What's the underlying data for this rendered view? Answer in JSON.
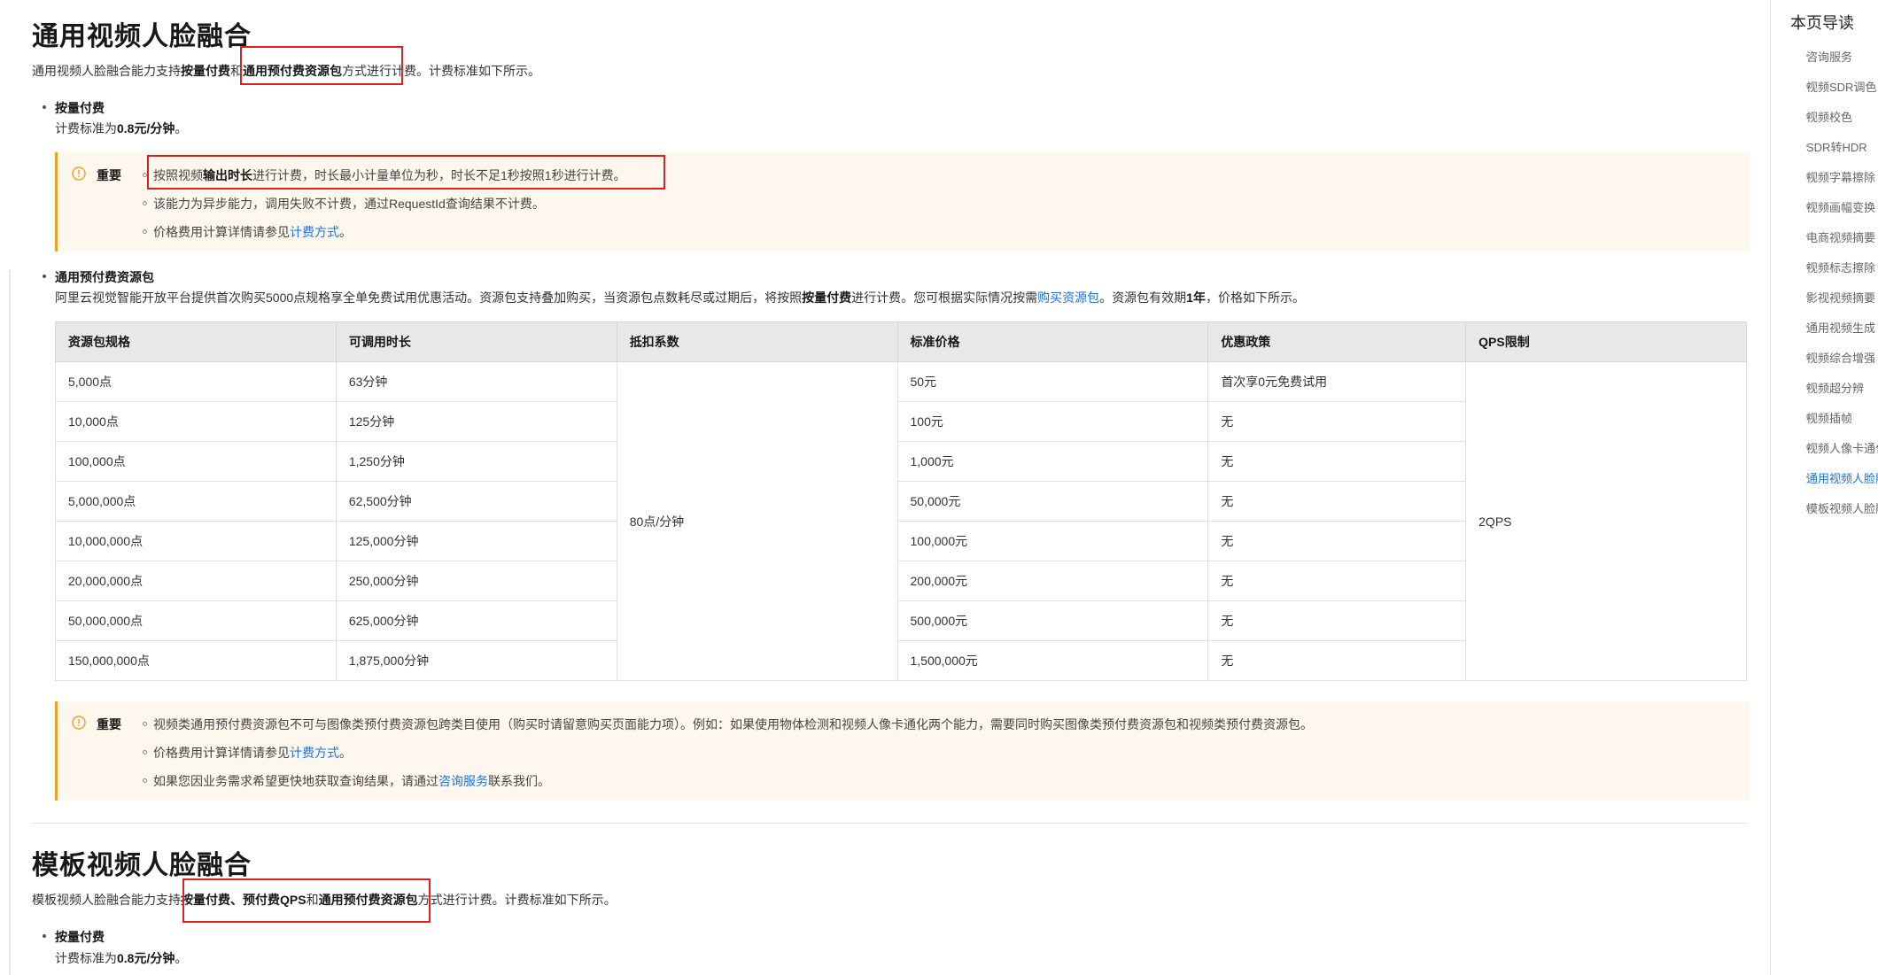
{
  "section1": {
    "title": "通用视频人脸融合",
    "intro_pre": "通用视频人脸融合能力支持",
    "intro_b1": "按量付费",
    "intro_mid": "和",
    "intro_b2": "通用预付费资源包",
    "intro_post": "方式进行计费。计费标准如下所示。",
    "payg_title": "按量付费",
    "payg_pre": "计费标准为",
    "payg_price": "0.8元/分钟",
    "payg_post": "。",
    "notice1": {
      "title": "重要",
      "item1_pre": "按照视频",
      "item1_b": "输出时长",
      "item1_post": "进行计费，时长最小计量单位为秒，时长不足1秒按照1秒进行计费。",
      "item2": "该能力为异步能力，调用失败不计费，通过RequestId查询结果不计费。",
      "item3_pre": "价格费用计算详情请参见",
      "item3_link": "计费方式",
      "item3_post": "。"
    },
    "prepaid_title": "通用预付费资源包",
    "prepaid_desc_pre": "阿里云视觉智能开放平台提供首次购买5000点规格享全单免费试用优惠活动。资源包支持叠加购买，当资源包点数耗尽或过期后，将按照",
    "prepaid_desc_b": "按量付费",
    "prepaid_desc_mid": "进行计费。您可根据实际情况按需",
    "prepaid_desc_link": "购买资源包",
    "prepaid_desc_mid2": "。资源包有效期",
    "prepaid_desc_b2": "1年",
    "prepaid_desc_post": "，价格如下所示。",
    "table": {
      "headers": [
        "资源包规格",
        "可调用时长",
        "抵扣系数",
        "标准价格",
        "优惠政策",
        "QPS限制"
      ],
      "deduction": "80点/分钟",
      "qps": "2QPS",
      "rows": [
        [
          "5,000点",
          "63分钟",
          "50元",
          "首次享0元免费试用"
        ],
        [
          "10,000点",
          "125分钟",
          "100元",
          "无"
        ],
        [
          "100,000点",
          "1,250分钟",
          "1,000元",
          "无"
        ],
        [
          "5,000,000点",
          "62,500分钟",
          "50,000元",
          "无"
        ],
        [
          "10,000,000点",
          "125,000分钟",
          "100,000元",
          "无"
        ],
        [
          "20,000,000点",
          "250,000分钟",
          "200,000元",
          "无"
        ],
        [
          "50,000,000点",
          "625,000分钟",
          "500,000元",
          "无"
        ],
        [
          "150,000,000点",
          "1,875,000分钟",
          "1,500,000元",
          "无"
        ]
      ]
    },
    "notice2": {
      "title": "重要",
      "item1": "视频类通用预付费资源包不可与图像类预付费资源包跨类目使用（购买时请留意购买页面能力项）。例如：如果使用物体检测和视频人像卡通化两个能力，需要同时购买图像类预付费资源包和视频类预付费资源包。",
      "item2_pre": "价格费用计算详情请参见",
      "item2_link": "计费方式",
      "item2_post": "。",
      "item3_pre": "如果您因业务需求希望更快地获取查询结果，请通过",
      "item3_link": "咨询服务",
      "item3_post": "联系我们。"
    }
  },
  "section2": {
    "title": "模板视频人脸融合",
    "intro_pre": "模板视频人脸融合能力支持",
    "intro_b": "按量付费、预付费QPS",
    "intro_mid": "和",
    "intro_b2": "通用预付费资源包",
    "intro_post": "方式进行计费。计费标准如下所示。",
    "payg_title": "按量付费",
    "payg_pre": "计费标准为",
    "payg_price": "0.8元/分钟",
    "payg_post": "。"
  },
  "sidebar": {
    "title": "本页导读",
    "items": [
      {
        "label": "咨询服务"
      },
      {
        "label": "视频SDR调色"
      },
      {
        "label": "视频校色"
      },
      {
        "label": "SDR转HDR"
      },
      {
        "label": "视频字幕擦除"
      },
      {
        "label": "视频画幅变换"
      },
      {
        "label": "电商视频摘要"
      },
      {
        "label": "视频标志擦除"
      },
      {
        "label": "影视视频摘要"
      },
      {
        "label": "通用视频生成"
      },
      {
        "label": "视频综合增强"
      },
      {
        "label": "视频超分辨"
      },
      {
        "label": "视频插帧"
      },
      {
        "label": "视频人像卡通化"
      },
      {
        "label": "通用视频人脸融合"
      },
      {
        "label": "模板视频人脸融合"
      }
    ]
  },
  "colors": {
    "accent": "#1a73e8",
    "notice_bg": "#fdf7ee",
    "notice_border": "#f0a020",
    "highlight_box": "#e02020"
  }
}
